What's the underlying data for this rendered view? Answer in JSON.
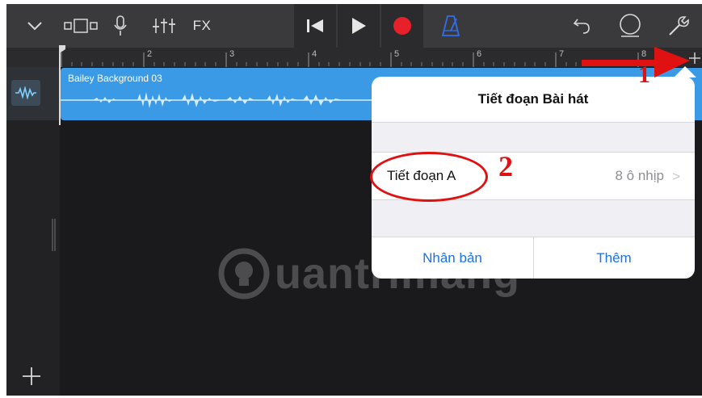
{
  "toolbar": {
    "fx_label": "FX",
    "icons": [
      "dropdown-icon",
      "view-switch-icon",
      "microphone-icon",
      "mixer-icon",
      "go-to-start-icon",
      "play-icon",
      "record-icon",
      "metronome-icon",
      "undo-icon",
      "loop-icon",
      "settings-wrench-icon"
    ],
    "record_color": "#e8202a",
    "metronome_color": "#2f6fea"
  },
  "ruler": {
    "bars": [
      "2",
      "3",
      "4",
      "5",
      "6",
      "7",
      "8"
    ]
  },
  "track": {
    "region_name": "Bailey Background 03",
    "region_color": "#3a9ae6"
  },
  "popup": {
    "title": "Tiết đoạn Bài hát",
    "section_label": "Tiết đoạn A",
    "section_value": "8 ô nhịp",
    "chevron": ">",
    "btn_duplicate": "Nhân bản",
    "btn_add": "Thêm"
  },
  "annotations": {
    "step1": "1",
    "step2": "2",
    "color": "#e01111"
  },
  "watermark": {
    "text": "uantrimang"
  }
}
